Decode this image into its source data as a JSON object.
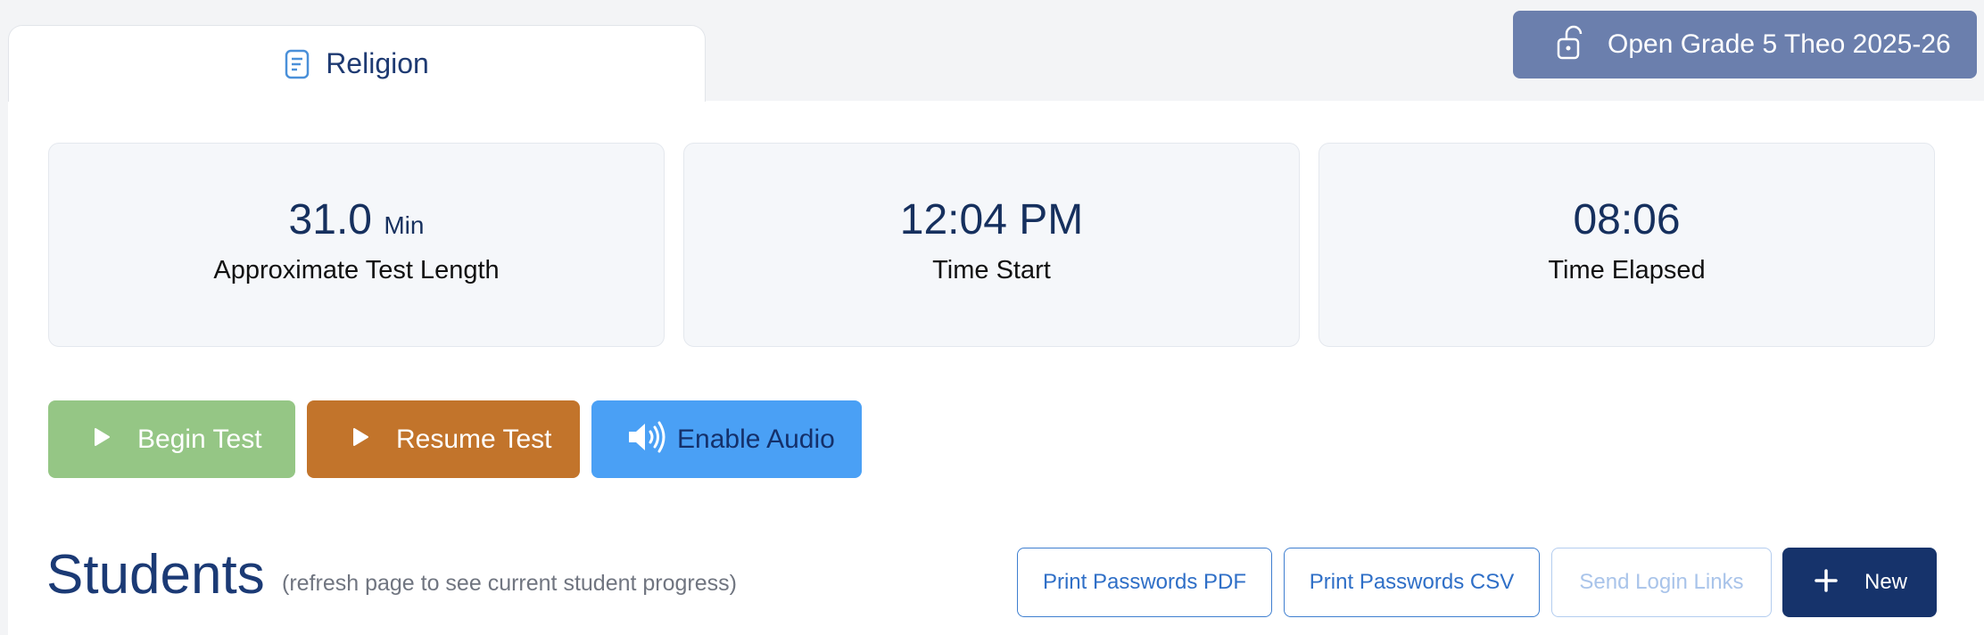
{
  "tab": {
    "label": "Religion",
    "icon": "document-icon"
  },
  "open_button": {
    "label": "Open Grade 5 Theo 2025-26",
    "icon": "unlock-icon"
  },
  "stats": [
    {
      "value": "31.0",
      "unit": "Min",
      "label": "Approximate Test Length"
    },
    {
      "value": "12:04 PM",
      "unit": "",
      "label": "Time Start"
    },
    {
      "value": "08:06",
      "unit": "",
      "label": "Time Elapsed"
    }
  ],
  "actions": {
    "begin": {
      "label": "Begin Test",
      "icon": "play-icon"
    },
    "resume": {
      "label": "Resume Test",
      "icon": "play-icon"
    },
    "audio": {
      "label": "Enable Audio",
      "icon": "speaker-icon"
    }
  },
  "students": {
    "title": "Students",
    "note": "(refresh page to see current student progress)",
    "print_pdf": "Print Passwords PDF",
    "print_csv": "Print Passwords CSV",
    "send_links": "Send Login Links",
    "new_label": "New"
  },
  "colors": {
    "primary_navy": "#16336b",
    "begin_green": "#95c685",
    "resume_orange": "#c2742b",
    "audio_blue": "#4aa0f5",
    "open_slate": "#6b7fad"
  }
}
